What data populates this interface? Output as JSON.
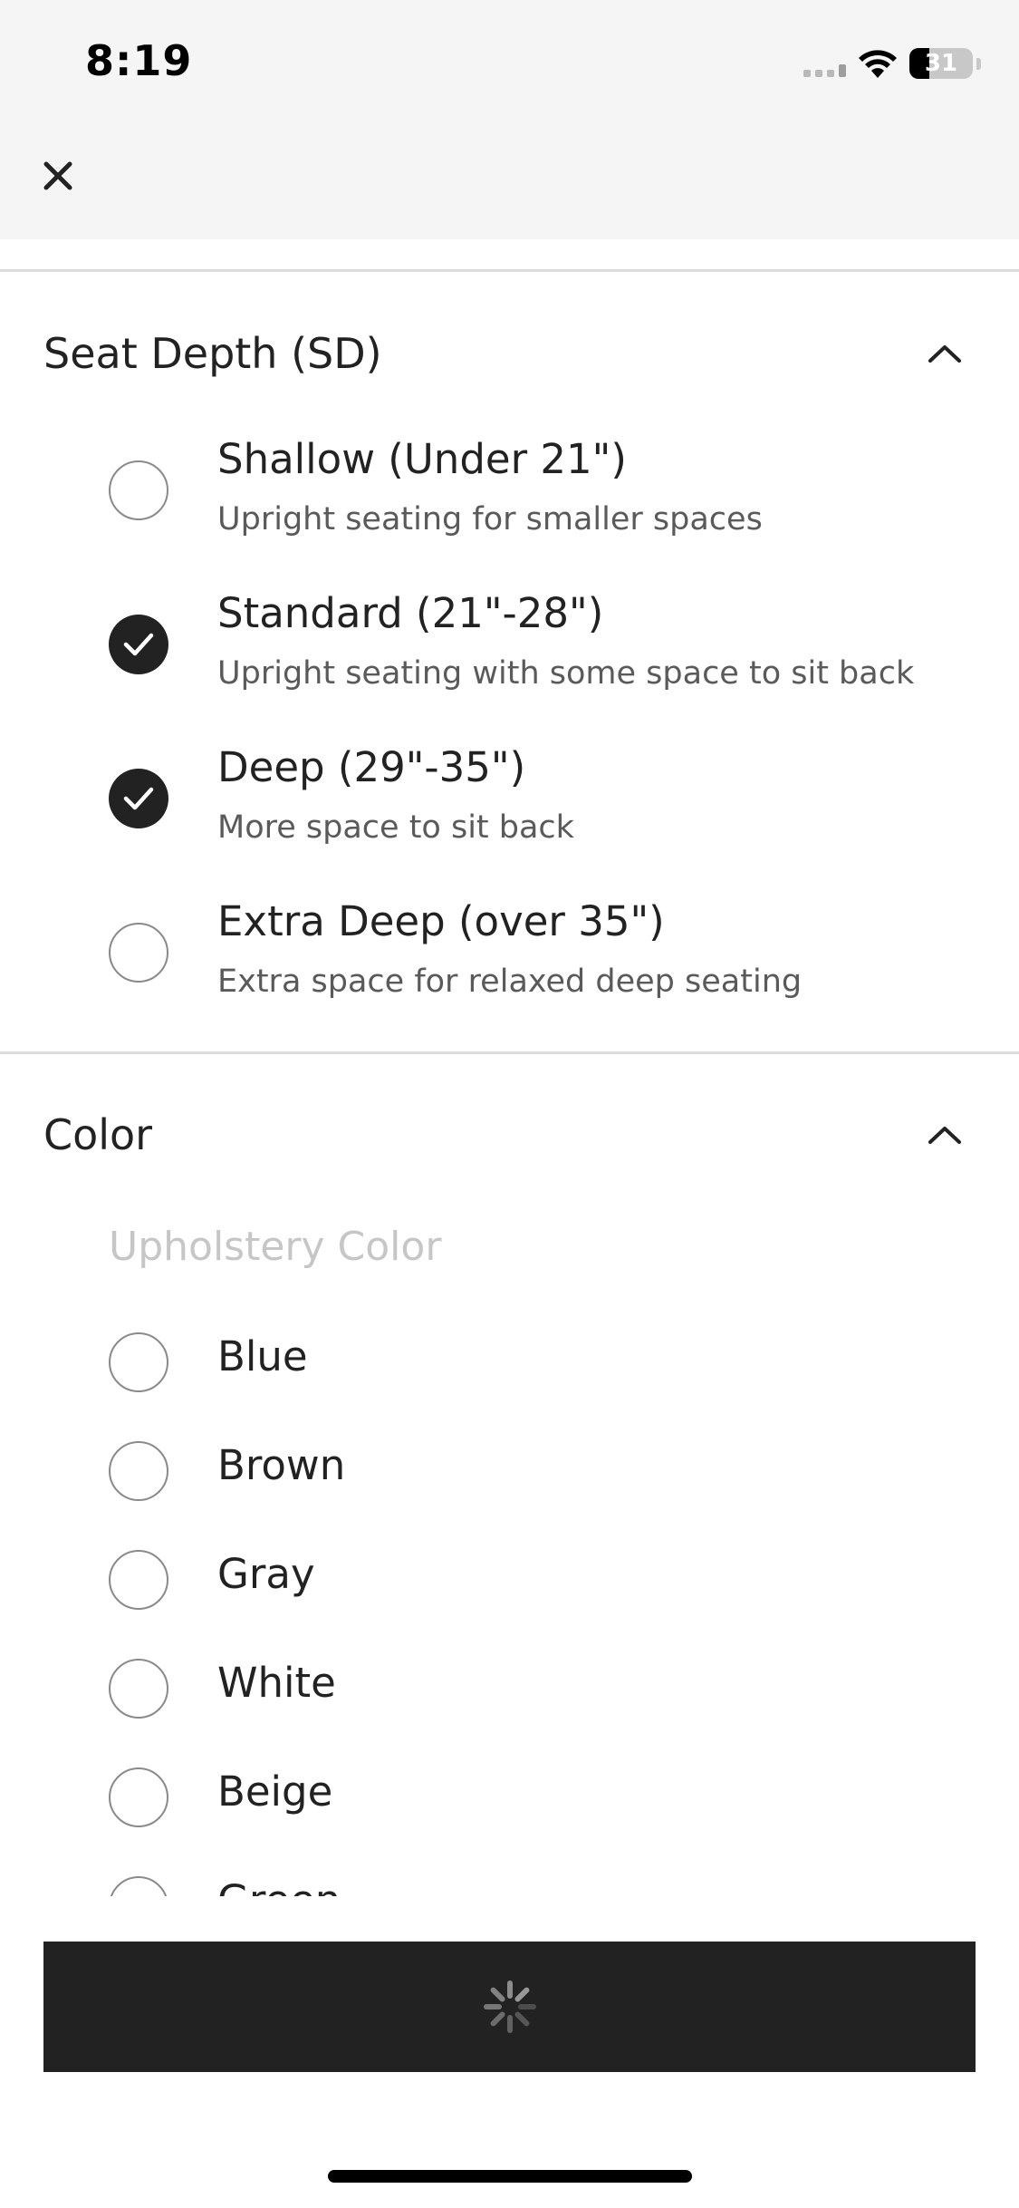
{
  "status_bar": {
    "time": "8:19",
    "battery_level": "31",
    "battery_fraction": 0.31
  },
  "header": {
    "close_icon": "close-icon"
  },
  "seat_depth": {
    "title": "Seat Depth (SD)",
    "expanded": true,
    "options": [
      {
        "label": "Shallow (Under 21\")",
        "description": "Upright seating for smaller spaces",
        "checked": false
      },
      {
        "label": "Standard (21\"-28\")",
        "description": "Upright seating with some space to sit back",
        "checked": true
      },
      {
        "label": "Deep (29\"-35\")",
        "description": "More space to sit back",
        "checked": true
      },
      {
        "label": "Extra Deep (over 35\")",
        "description": "Extra space for relaxed deep seating",
        "checked": false
      }
    ]
  },
  "color": {
    "title": "Color",
    "expanded": true,
    "group_label": "Upholstery Color",
    "options": [
      {
        "label": "Blue",
        "checked": false
      },
      {
        "label": "Brown",
        "checked": false
      },
      {
        "label": "Gray",
        "checked": false
      },
      {
        "label": "White",
        "checked": false
      },
      {
        "label": "Beige",
        "checked": false
      },
      {
        "label": "Green",
        "checked": false
      }
    ]
  },
  "apply_button": {
    "state": "loading",
    "icon": "spinner-icon"
  },
  "colors": {
    "header_bg": "#f5f5f5",
    "button_bg": "#222222",
    "checked_bg": "#222222",
    "divider": "#dcdcdc",
    "muted_text": "#c6c6c6"
  }
}
